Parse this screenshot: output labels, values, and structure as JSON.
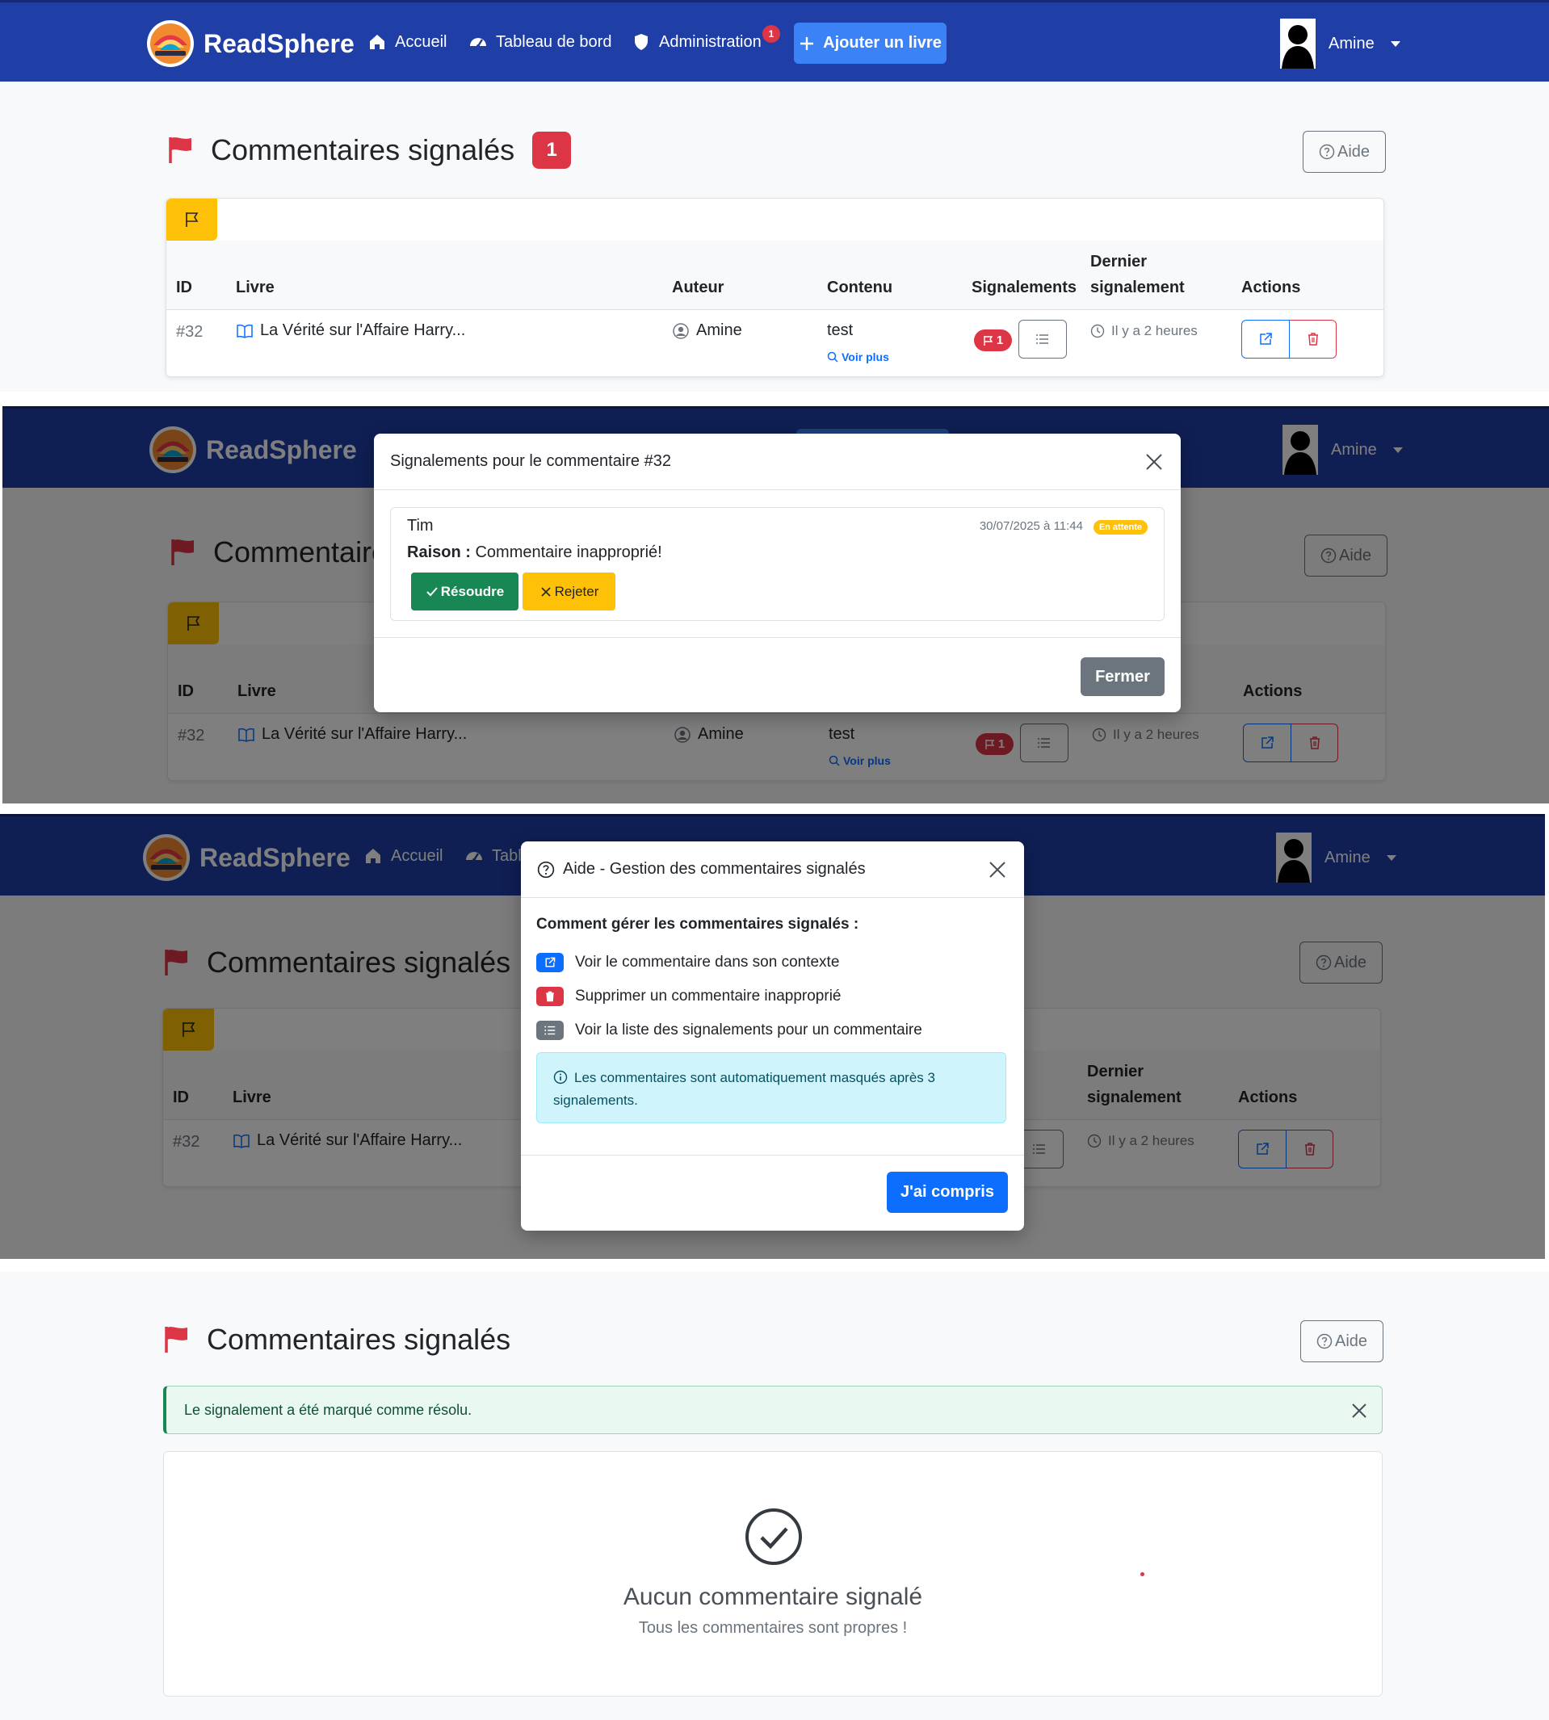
{
  "navbar": {
    "brand": "ReadSphere",
    "home": "Accueil",
    "dashboard": "Tableau de bord",
    "admin": "Administration",
    "admin_badge": "1",
    "add_book": "Ajouter un livre",
    "user": "Amine"
  },
  "page": {
    "title": "Commentaires signalés",
    "count": "1",
    "help_button": "Aide"
  },
  "table": {
    "headers": {
      "id": "ID",
      "book": "Livre",
      "author": "Auteur",
      "content": "Contenu",
      "reports": "Signalements",
      "last_report_line1": "Dernier",
      "last_report_line2": "signalement",
      "actions": "Actions"
    },
    "row": {
      "id": "#32",
      "book": "La Vérité sur l'Affaire Harry...",
      "author": "Amine",
      "content": "test",
      "see_more": "Voir plus",
      "report_count": "1",
      "last_report": "Il y a 2 heures"
    }
  },
  "report_modal": {
    "title": "Signalements pour le commentaire #32",
    "reporter": "Tim",
    "date": "30/07/2025 à 11:44",
    "status": "En attente",
    "reason_label": "Raison :",
    "reason_text": "Commentaire inapproprié!",
    "resolve": "Résoudre",
    "reject": "Rejeter",
    "close": "Fermer"
  },
  "help_modal": {
    "title": "Aide - Gestion des commentaires signalés",
    "heading": "Comment gérer les commentaires signalés :",
    "items": [
      "Voir le commentaire dans son contexte",
      "Supprimer un commentaire inapproprié",
      "Voir la liste des signalements pour un commentaire"
    ],
    "info": "Les commentaires sont automatiquement masqués après 3 signalements.",
    "ok": "J'ai compris"
  },
  "success_state": {
    "alert": "Le signalement a été marqué comme résolu.",
    "empty_title": "Aucun commentaire signalé",
    "empty_subtitle": "Tous les commentaires sont propres !"
  },
  "colors": {
    "navbar": "#1f3ea6",
    "primary": "#0d6efd",
    "danger": "#dc3545",
    "warning": "#ffc107",
    "success": "#198754",
    "secondary": "#6c757d"
  }
}
